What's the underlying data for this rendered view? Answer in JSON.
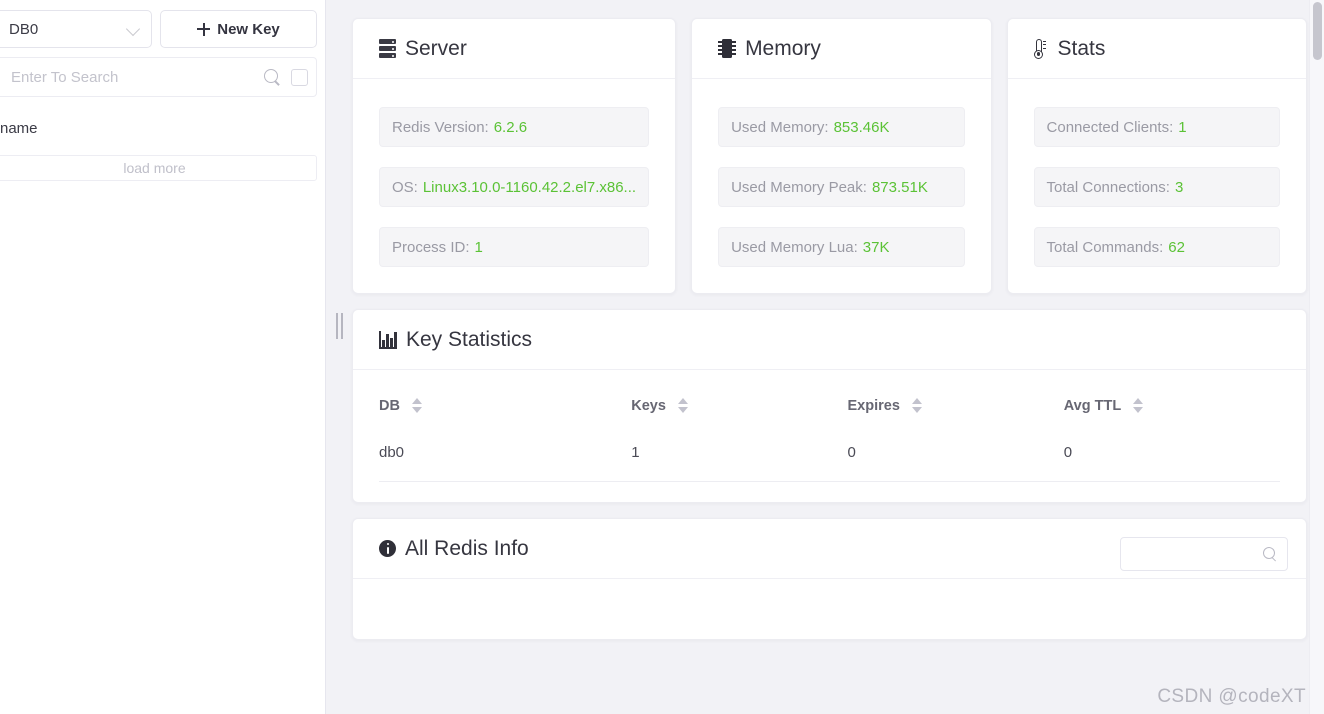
{
  "sidebar": {
    "db_select": {
      "value": "DB0",
      "icon": "chevron-down-icon"
    },
    "new_key_button": {
      "label": "New Key",
      "icon": "plus-icon"
    },
    "search": {
      "value": "",
      "placeholder": "Enter To Search",
      "icon": "search-icon"
    },
    "keys": [
      {
        "name": "name"
      }
    ],
    "load_more_label": "load more"
  },
  "cards": {
    "server": {
      "title": "Server",
      "icon": "server-icon",
      "rows": [
        {
          "label": "Redis Version:",
          "value": "6.2.6"
        },
        {
          "label": "OS:",
          "value": "Linux3.10.0-1160.42.2.el7.x86..."
        },
        {
          "label": "Process ID:",
          "value": "1"
        }
      ]
    },
    "memory": {
      "title": "Memory",
      "icon": "memory-chip-icon",
      "rows": [
        {
          "label": "Used Memory:",
          "value": "853.46K"
        },
        {
          "label": "Used Memory Peak:",
          "value": "873.51K"
        },
        {
          "label": "Used Memory Lua:",
          "value": "37K"
        }
      ]
    },
    "stats": {
      "title": "Stats",
      "icon": "thermometer-icon",
      "rows": [
        {
          "label": "Connected Clients:",
          "value": "1"
        },
        {
          "label": "Total Connections:",
          "value": "3"
        },
        {
          "label": "Total Commands:",
          "value": "62"
        }
      ]
    }
  },
  "key_statistics": {
    "title": "Key Statistics",
    "icon": "bar-chart-icon",
    "columns": [
      "DB",
      "Keys",
      "Expires",
      "Avg TTL"
    ],
    "rows": [
      {
        "db": "db0",
        "keys": "1",
        "expires": "0",
        "avg_ttl": "0"
      }
    ]
  },
  "all_redis_info": {
    "title": "All Redis Info",
    "icon": "info-icon",
    "search": {
      "value": "",
      "placeholder": "",
      "icon": "search-icon"
    }
  },
  "colors": {
    "value_green": "#5bc236",
    "label_gray": "#9a9aa4",
    "page_bg": "#f2f2f6"
  },
  "watermark": "CSDN @codeXT"
}
